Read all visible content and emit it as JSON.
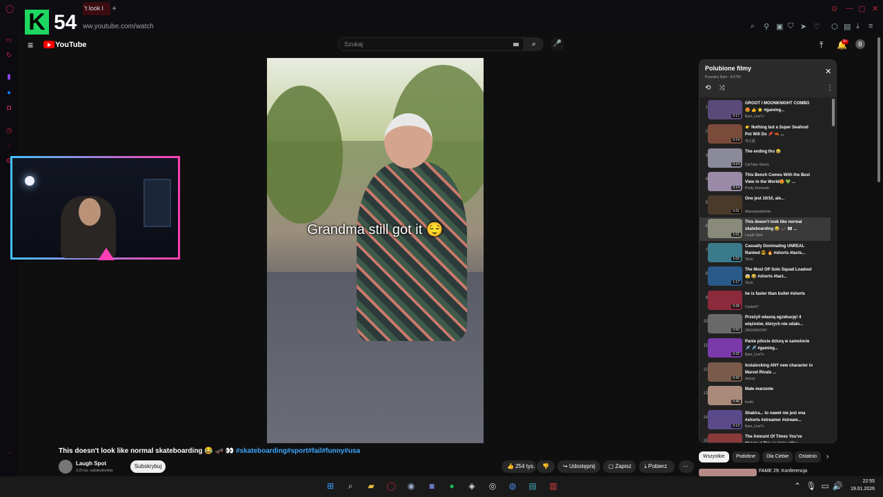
{
  "browser": {
    "tab_title": "'t look l",
    "url": "ww.youtube.com/watch"
  },
  "overlay": {
    "kick_logo": "K",
    "viewer_count": "54"
  },
  "youtube": {
    "logo_text": "YouTube",
    "search_placeholder": "Szukaj"
  },
  "video": {
    "caption": "Grandma still got it 😌",
    "title": "This doesn't look like normal skateboarding 😂 🛹 👀 ",
    "hashtags": "#skateboarding#sport#fail#funny#usa",
    "channel": "Laugh Spot",
    "subscribers": "3,25 tys. subskrybentów",
    "subscribe_label": "Subskrybuj",
    "likes": "254 tys.",
    "share_label": "Udostępnij",
    "save_label": "Zapisz",
    "download_label": "Pobierz"
  },
  "playlist": {
    "title": "Polubione filmy",
    "subtitle": "Prywatny Bam - 6/1760",
    "items": [
      {
        "num": "1",
        "title": "GROOT I MOONKNIGHT COMBO 😍 👍 ⭐ #gaming...",
        "channel": "Bam_LiveTv",
        "duration": "0:17",
        "color": "#5a4a7a"
      },
      {
        "num": "2",
        "title": "👉 Nothing but a Super Seafood Pot Will Do 📌 🦐 ...",
        "channel": "市工民",
        "duration": "0:14",
        "color": "#7a4a3a"
      },
      {
        "num": "3",
        "title": "The ending tho 😂",
        "channel": "CatTube Shorts",
        "duration": "0:14",
        "color": "#8a8a9a"
      },
      {
        "num": "4",
        "title": "This Bench Comes With the Best View in the World😍 💚 ...",
        "channel": "Pretty Romantic",
        "duration": "0:14",
        "color": "#9a8aa8"
      },
      {
        "num": "5",
        "title": "One jest 10/10, ale...",
        "channel": "WarszawskiKoks",
        "duration": "0:21",
        "color": "#4a3a2a"
      },
      {
        "num": "6",
        "title": "This doesn't look like normal skateboarding 😂 🛹 👀 ...",
        "channel": "Laugh Spot",
        "duration": "1:01",
        "color": "#8a8a7a"
      },
      {
        "num": "7",
        "title": "Casually Dominating UNREAL Ranked 😎 🔥 #shorts #tacts...",
        "channel": "Tacts",
        "duration": "1:02",
        "color": "#3a7a8a"
      },
      {
        "num": "8",
        "title": "The Most OP Solo Squad Loadout 😱 😂 #shorts #tact...",
        "channel": "Tacts",
        "duration": "1:17",
        "color": "#2a5a8a"
      },
      {
        "num": "9",
        "title": "he is faster than bullet #shorts",
        "channel": "Caske57",
        "duration": "0:28",
        "color": "#8a2a3a"
      },
      {
        "num": "10",
        "title": "Przeżyli własną egzekucję! 4 więźniów, których nie udało...",
        "channel": "ZAGADKOWY",
        "duration": "0:50",
        "color": "#6a6a6a"
      },
      {
        "num": "11",
        "title": "Panie pilocie dziurą w samolocie ✈️ ✈️ #gaming...",
        "channel": "Bam_LiveTv",
        "duration": "0:32",
        "color": "#7a3aaa"
      },
      {
        "num": "12",
        "title": "Instalocking ANY new character in Marvel Rivals ...",
        "channel": "deluxe",
        "duration": "0:42",
        "color": "#7a5a4a"
      },
      {
        "num": "13",
        "title": "Małe marzenie",
        "channel": "krotki",
        "duration": "0:46",
        "color": "#aa8a7a"
      },
      {
        "num": "14",
        "title": "Shakira... to nawet nie jest ona #shorts #streamer #stream...",
        "channel": "Bam_LiveTv",
        "duration": "0:13",
        "color": "#5a4a8a"
      },
      {
        "num": "15",
        "title": "The Amount Of Times You've Watched This is Unhealthy...",
        "channel": "",
        "duration": "",
        "color": "#8a3a3a"
      }
    ]
  },
  "chips": [
    "Wszystkie",
    "Podobne",
    "Dla Ciebie",
    "Ostatnio"
  ],
  "next_video": {
    "title": "FAME 29: Konferencja"
  },
  "clock": {
    "time": "22:55",
    "date": "19.01.2026"
  }
}
